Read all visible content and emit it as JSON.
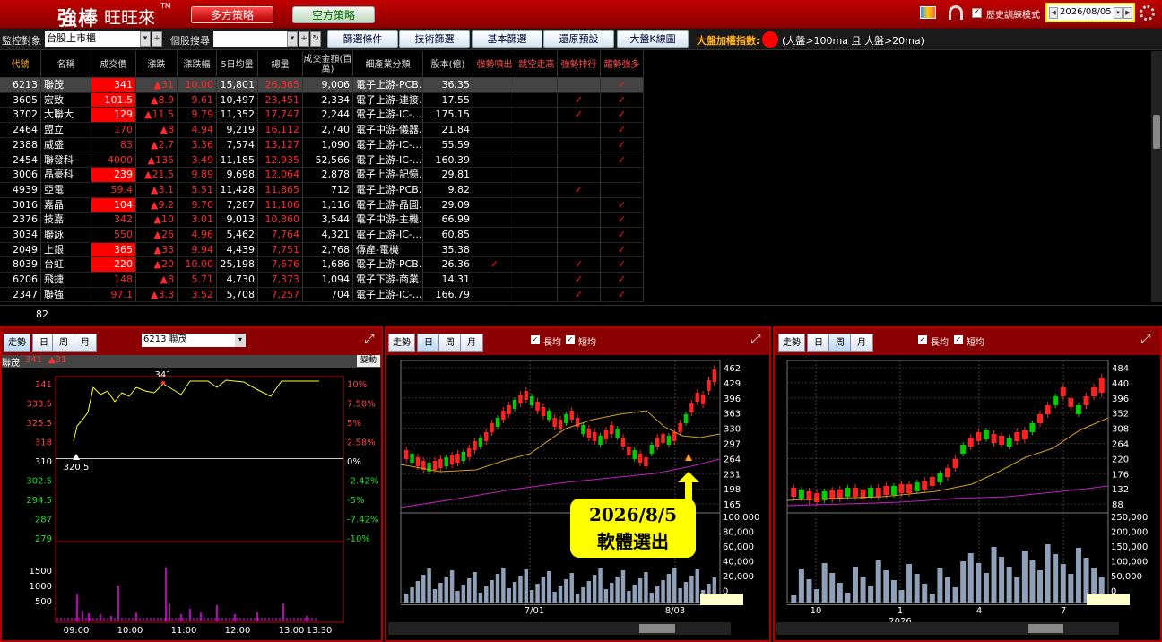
{
  "header": {
    "logo_strong": "強棒",
    "logo_rest": "旺旺來",
    "logo_tm": "TM",
    "tab_long": "多方策略",
    "tab_short": "空方策略",
    "history_mode_label": "歷史訓練模式",
    "history_mode_checked": "✓",
    "date": "2026/08/05"
  },
  "toolbar": {
    "monitor_label": "監控對象",
    "market": "台股上市櫃",
    "stock_search_label": "個股搜尋",
    "buttons": [
      "篩選條件",
      "技術篩選",
      "基本篩選",
      "還原預設",
      "大盤K線圖"
    ],
    "index_label": "大盤加權指數:",
    "index_condition": "(大盤>100ma 且 大盤>20ma)"
  },
  "table": {
    "columns": [
      "代號",
      "名稱",
      "成交價",
      "漲跌",
      "漲跌幅",
      "5日均量",
      "總量",
      "成交金額(百萬)",
      "細產業分類",
      "股本(億)",
      "強勢噴出",
      "跳空走高",
      "強勢排行",
      "趨勢強多"
    ],
    "rows": [
      {
        "code": "6213",
        "name": "聯茂",
        "price": "341",
        "change": "▲31",
        "pct": "10.00",
        "avg5": "15,801",
        "vol": "26,865",
        "amount": "9,006",
        "industry": "電子上游-PCB...",
        "capital": "36.35",
        "c1": "",
        "c2": "",
        "c3": "",
        "c4": "✓",
        "limit": true
      },
      {
        "code": "3605",
        "name": "宏致",
        "price": "101.5",
        "change": "▲8.9",
        "pct": "9.61",
        "avg5": "10,497",
        "vol": "23,451",
        "amount": "2,334",
        "industry": "電子上游-連接...",
        "capital": "17.55",
        "c1": "",
        "c2": "",
        "c3": "✓",
        "c4": "✓",
        "limit": true
      },
      {
        "code": "3702",
        "name": "大聯大",
        "price": "129",
        "change": "▲11.5",
        "pct": "9.79",
        "avg5": "11,352",
        "vol": "17,747",
        "amount": "2,244",
        "industry": "電子上游-IC-...",
        "capital": "175.15",
        "c1": "",
        "c2": "",
        "c3": "✓",
        "c4": "✓",
        "limit": true
      },
      {
        "code": "2464",
        "name": "盟立",
        "price": "170",
        "change": "▲8",
        "pct": "4.94",
        "avg5": "9,219",
        "vol": "16,112",
        "amount": "2,740",
        "industry": "電子中游-儀器...",
        "capital": "21.84",
        "c1": "",
        "c2": "",
        "c3": "",
        "c4": "✓",
        "limit": false
      },
      {
        "code": "2388",
        "name": "威盛",
        "price": "83",
        "change": "▲2.7",
        "pct": "3.36",
        "avg5": "7,574",
        "vol": "13,127",
        "amount": "1,090",
        "industry": "電子上游-IC-...",
        "capital": "55.59",
        "c1": "",
        "c2": "",
        "c3": "",
        "c4": "✓",
        "limit": false
      },
      {
        "code": "2454",
        "name": "聯發科",
        "price": "4000",
        "change": "▲135",
        "pct": "3.49",
        "avg5": "11,185",
        "vol": "12,935",
        "amount": "52,566",
        "industry": "電子上游-IC-...",
        "capital": "160.39",
        "c1": "",
        "c2": "",
        "c3": "",
        "c4": "✓",
        "limit": false
      },
      {
        "code": "3006",
        "name": "晶豪科",
        "price": "239",
        "change": "▲21.5",
        "pct": "9.89",
        "avg5": "9,698",
        "vol": "12,064",
        "amount": "2,878",
        "industry": "電子上游-記憶...",
        "capital": "29.81",
        "c1": "",
        "c2": "",
        "c3": "",
        "c4": "",
        "limit": true
      },
      {
        "code": "4939",
        "name": "亞電",
        "price": "59.4",
        "change": "▲3.1",
        "pct": "5.51",
        "avg5": "11,428",
        "vol": "11,865",
        "amount": "712",
        "industry": "電子上游-PCB...",
        "capital": "9.82",
        "c1": "",
        "c2": "",
        "c3": "✓",
        "c4": "",
        "limit": false
      },
      {
        "code": "3016",
        "name": "嘉晶",
        "price": "104",
        "change": "▲9.2",
        "pct": "9.70",
        "avg5": "7,287",
        "vol": "11,106",
        "amount": "1,116",
        "industry": "電子上游-晶圓...",
        "capital": "29.09",
        "c1": "",
        "c2": "",
        "c3": "",
        "c4": "✓",
        "limit": true
      },
      {
        "code": "2376",
        "name": "技嘉",
        "price": "342",
        "change": "▲10",
        "pct": "3.01",
        "avg5": "9,013",
        "vol": "10,360",
        "amount": "3,544",
        "industry": "電子中游-主機...",
        "capital": "66.99",
        "c1": "",
        "c2": "",
        "c3": "",
        "c4": "✓",
        "limit": false
      },
      {
        "code": "3034",
        "name": "聯詠",
        "price": "550",
        "change": "▲26",
        "pct": "4.96",
        "avg5": "5,462",
        "vol": "7,764",
        "amount": "4,321",
        "industry": "電子上游-IC-...",
        "capital": "60.85",
        "c1": "",
        "c2": "",
        "c3": "",
        "c4": "✓",
        "limit": false
      },
      {
        "code": "2049",
        "name": "上銀",
        "price": "365",
        "change": "▲33",
        "pct": "9.94",
        "avg5": "4,439",
        "vol": "7,751",
        "amount": "2,768",
        "industry": "傳產-電機",
        "capital": "35.38",
        "c1": "",
        "c2": "",
        "c3": "",
        "c4": "✓",
        "limit": true
      },
      {
        "code": "8039",
        "name": "台虹",
        "price": "220",
        "change": "▲20",
        "pct": "10.00",
        "avg5": "25,198",
        "vol": "7,676",
        "amount": "1,686",
        "industry": "電子上游-PCB...",
        "capital": "26.36",
        "c1": "✓",
        "c2": "",
        "c3": "✓",
        "c4": "✓",
        "limit": true
      },
      {
        "code": "6206",
        "name": "飛捷",
        "price": "148",
        "change": "▲8",
        "pct": "5.71",
        "avg5": "4,730",
        "vol": "7,373",
        "amount": "1,094",
        "industry": "電子下游-商業...",
        "capital": "14.31",
        "c1": "",
        "c2": "",
        "c3": "✓",
        "c4": "✓",
        "limit": false
      },
      {
        "code": "2347",
        "name": "聯強",
        "price": "97.1",
        "change": "▲3.3",
        "pct": "3.52",
        "avg5": "5,708",
        "vol": "7,257",
        "amount": "704",
        "industry": "電子上游-IC-...",
        "capital": "166.79",
        "c1": "",
        "c2": "",
        "c3": "✓",
        "c4": "✓",
        "limit": false
      }
    ],
    "count": "82"
  },
  "panel1": {
    "tabs": [
      "走勢",
      "日",
      "周",
      "月"
    ],
    "stock_select": "6213 聯茂",
    "title_name": "聯茂",
    "title_price": "341",
    "title_change": "▲31",
    "change_btn": "變動",
    "price_axis": [
      "341",
      "333.5",
      "325.5",
      "318",
      "310",
      "302.5",
      "294.5",
      "287",
      "279"
    ],
    "pct_axis": [
      "10%",
      "7.58%",
      "5%",
      "2.58%",
      "0%",
      "-2.42%",
      "-5%",
      "-7.42%",
      "-10%"
    ],
    "vol_axis": [
      "1500",
      "1000",
      "500"
    ],
    "time_axis": [
      "09:00",
      "10:00",
      "11:00",
      "12:00",
      "13:00",
      "13:30"
    ],
    "high_label": "341",
    "low_label": "320.5"
  },
  "panel2": {
    "tabs": [
      "走勢",
      "日",
      "周",
      "月"
    ],
    "ma_long": "長均",
    "ma_short": "短均",
    "checked": "✓",
    "price_axis": [
      "462",
      "429",
      "396",
      "363",
      "330",
      "297",
      "264",
      "231",
      "198",
      "165"
    ],
    "vol_axis": [
      "100,000",
      "80,000",
      "60,000",
      "40,000",
      "20,000",
      "0"
    ],
    "x_axis": [
      "7/01",
      "8/03"
    ],
    "callout_line1": "2026/8/5",
    "callout_line2": "軟體選出"
  },
  "panel3": {
    "tabs": [
      "走勢",
      "日",
      "周",
      "月"
    ],
    "ma_long": "長均",
    "ma_short": "短均",
    "checked": "✓",
    "price_axis": [
      "484",
      "440",
      "396",
      "352",
      "308",
      "264",
      "220",
      "176",
      "132",
      "88"
    ],
    "vol_axis": [
      "250,000",
      "200,000",
      "150,000",
      "100,000",
      "50,000",
      "0"
    ],
    "x_axis": [
      "10",
      "1",
      "4",
      "7"
    ],
    "year_label": "2026"
  }
}
